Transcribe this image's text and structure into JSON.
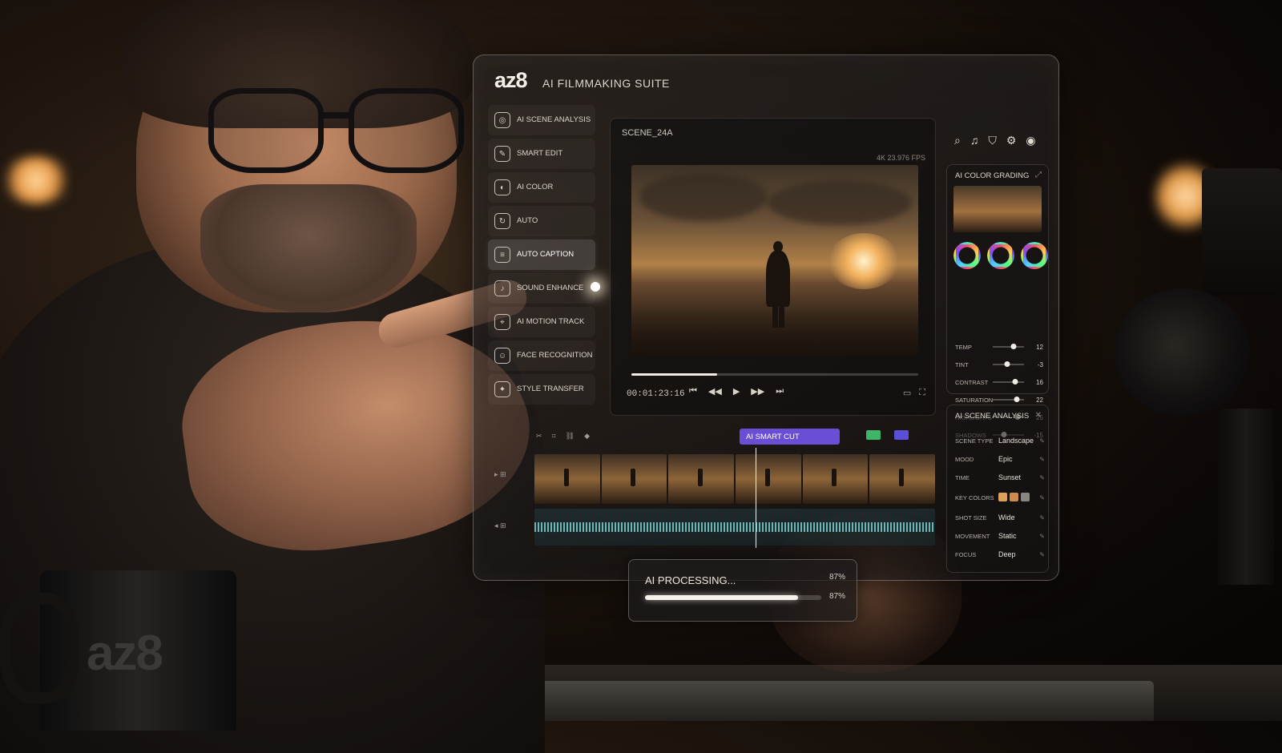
{
  "app": {
    "brand": "az8",
    "suite": "AI FILMMAKING SUITE"
  },
  "sidebar": {
    "items": [
      {
        "label": "AI SCENE ANALYSIS",
        "icon": "scene-icon",
        "active": false
      },
      {
        "label": "SMART EDIT",
        "icon": "edit-icon",
        "active": false
      },
      {
        "label": "AI COLOR",
        "icon": "color-icon",
        "active": false
      },
      {
        "label": "AUTO",
        "icon": "auto-icon",
        "active": false
      },
      {
        "label": "AUTO CAPTION",
        "icon": "caption-icon",
        "active": true
      },
      {
        "label": "SOUND ENHANCE",
        "icon": "sound-icon",
        "active": false
      },
      {
        "label": "AI MOTION TRACK",
        "icon": "motion-icon",
        "active": false
      },
      {
        "label": "FACE RECOGNITION",
        "icon": "face-icon",
        "active": false
      },
      {
        "label": "STYLE TRANSFER",
        "icon": "style-icon",
        "active": false
      }
    ]
  },
  "viewer": {
    "scene_name": "SCENE_24A",
    "format": "4K 23.976 FPS",
    "timecode": "00:01:23:16",
    "playback_progress": 0.3
  },
  "header_tools": [
    "search-icon",
    "bell-icon",
    "shield-icon",
    "settings-icon",
    "user-icon"
  ],
  "color_grading": {
    "title": "AI COLOR GRADING",
    "sliders": [
      {
        "label": "TEMP",
        "value": "12",
        "level": 0.65
      },
      {
        "label": "TINT",
        "value": "-3",
        "level": 0.45
      },
      {
        "label": "CONTRAST",
        "value": "16",
        "level": 0.7
      },
      {
        "label": "SATURATION",
        "value": "22",
        "level": 0.75
      },
      {
        "label": "HIGHLIGHTS",
        "value": "25",
        "level": 0.78
      },
      {
        "label": "SHADOWS",
        "value": "-15",
        "level": 0.35
      }
    ]
  },
  "scene_analysis": {
    "title": "AI SCENE ANALYSIS",
    "rows": [
      {
        "key": "SCENE TYPE",
        "value": "Landscape"
      },
      {
        "key": "MOOD",
        "value": "Epic"
      },
      {
        "key": "TIME",
        "value": "Sunset"
      },
      {
        "key": "KEY COLORS",
        "value": ""
      },
      {
        "key": "SHOT SIZE",
        "value": "Wide"
      },
      {
        "key": "MOVEMENT",
        "value": "Static"
      },
      {
        "key": "FOCUS",
        "value": "Deep"
      }
    ],
    "key_colors": [
      "#d9a25a",
      "#c98c4c",
      "#8a8680"
    ]
  },
  "timeline": {
    "smart_cut_label": "AI SMART CUT",
    "accent": "#6a4fd6"
  },
  "processing": {
    "label": "AI PROCESSING...",
    "percent_text": "87%",
    "progress": 0.87
  },
  "mug": {
    "logo": "az8"
  }
}
